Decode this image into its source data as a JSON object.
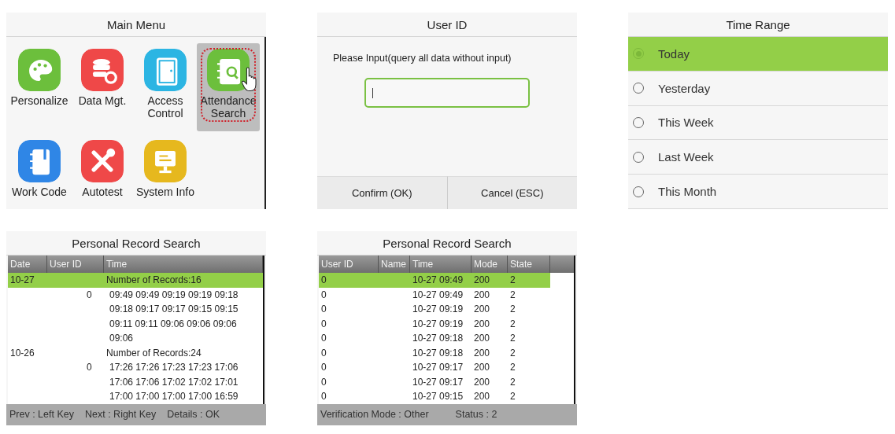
{
  "main_menu": {
    "title": "Main Menu",
    "items": [
      {
        "label": "Personalize",
        "kind": "palette",
        "color": "#6cbf3c",
        "selected": false
      },
      {
        "label": "Data Mgt.",
        "kind": "database",
        "color": "#ef4848",
        "selected": false
      },
      {
        "label": "Access Control",
        "kind": "door",
        "color": "#2cb5e3",
        "selected": false
      },
      {
        "label": "Attendance Search",
        "kind": "book-search",
        "color": "#6cbf3c",
        "selected": true
      },
      {
        "label": "Work Code",
        "kind": "notebook",
        "color": "#2f86e6",
        "selected": false
      },
      {
        "label": "Autotest",
        "kind": "tools",
        "color": "#ef4848",
        "selected": false
      },
      {
        "label": "System Info",
        "kind": "monitor",
        "color": "#e6b81e",
        "selected": false
      }
    ]
  },
  "user_id_dialog": {
    "title": "User ID",
    "prompt": "Please Input(query all data without input)",
    "buttons": [
      "Confirm (OK)",
      "Cancel (ESC)"
    ]
  },
  "time_range": {
    "title": "Time Range",
    "options": [
      {
        "label": "Today",
        "selected": true
      },
      {
        "label": "Yesterday",
        "selected": false
      },
      {
        "label": "This Week",
        "selected": false
      },
      {
        "label": "Last Week",
        "selected": false
      },
      {
        "label": "This Month",
        "selected": false
      }
    ]
  },
  "record_search_by_date": {
    "title": "Personal Record Search",
    "columns": [
      "Date",
      "User ID",
      "Time"
    ],
    "rows": [
      {
        "kind": "summary",
        "date": "10-27",
        "time": "Number of Records:16",
        "selected": true
      },
      {
        "kind": "times",
        "user_id": "0",
        "time": "09:49 09:49 09:19 09:19 09:18",
        "selected": false
      },
      {
        "kind": "times",
        "time": "09:18 09:17 09:17 09:15 09:15",
        "selected": false
      },
      {
        "kind": "times",
        "time": "09:11 09:11 09:06 09:06 09:06",
        "selected": false
      },
      {
        "kind": "times",
        "time": "09:06",
        "selected": false
      },
      {
        "kind": "summary",
        "date": "10-26",
        "time": "Number of Records:24",
        "selected": false
      },
      {
        "kind": "times",
        "user_id": "0",
        "time": "17:26 17:26 17:23 17:23 17:06",
        "selected": false
      },
      {
        "kind": "times",
        "time": "17:06 17:06 17:02 17:02 17:01",
        "selected": false
      },
      {
        "kind": "times",
        "time": "17:00 17:00 17:00 17:00 16:59",
        "selected": false
      }
    ],
    "footer": [
      "Prev : Left Key",
      "Next : Right Key",
      "Details : OK"
    ]
  },
  "record_search_list": {
    "title": "Personal Record Search",
    "columns": [
      "User ID",
      "Name",
      "Time",
      "Mode",
      "State"
    ],
    "rows": [
      {
        "user_id": "0",
        "time": "10-27 09:49",
        "mode": "200",
        "state": "2",
        "selected": true
      },
      {
        "user_id": "0",
        "time": "10-27 09:49",
        "mode": "200",
        "state": "2",
        "selected": false
      },
      {
        "user_id": "0",
        "time": "10-27 09:19",
        "mode": "200",
        "state": "2",
        "selected": false
      },
      {
        "user_id": "0",
        "time": "10-27 09:19",
        "mode": "200",
        "state": "2",
        "selected": false
      },
      {
        "user_id": "0",
        "time": "10-27 09:18",
        "mode": "200",
        "state": "2",
        "selected": false
      },
      {
        "user_id": "0",
        "time": "10-27 09:18",
        "mode": "200",
        "state": "2",
        "selected": false
      },
      {
        "user_id": "0",
        "time": "10-27 09:17",
        "mode": "200",
        "state": "2",
        "selected": false
      },
      {
        "user_id": "0",
        "time": "10-27 09:17",
        "mode": "200",
        "state": "2",
        "selected": false
      },
      {
        "user_id": "0",
        "time": "10-27 09:15",
        "mode": "200",
        "state": "2",
        "selected": false
      }
    ],
    "footer": [
      "Verification Mode : Other",
      "Status : 2"
    ]
  }
}
